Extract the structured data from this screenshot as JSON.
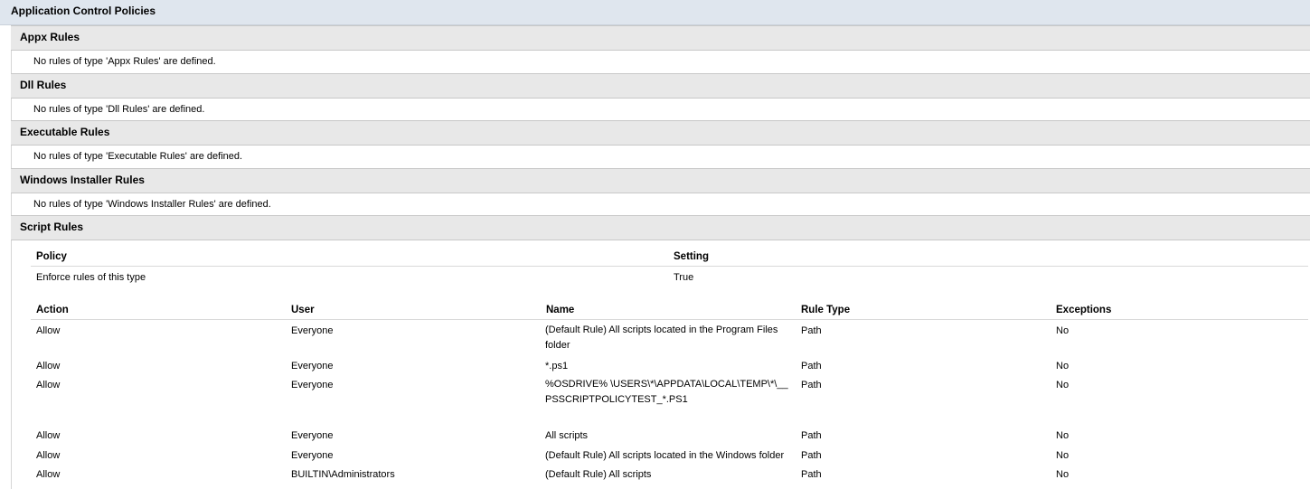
{
  "title": "Application Control Policies",
  "sections": [
    {
      "name": "Appx Rules",
      "message": "No rules of type 'Appx Rules' are defined."
    },
    {
      "name": "Dll Rules",
      "message": "No rules of type 'Dll Rules' are defined."
    },
    {
      "name": "Executable Rules",
      "message": "No rules of type 'Executable Rules' are defined."
    },
    {
      "name": "Windows Installer Rules",
      "message": "No rules of type 'Windows Installer Rules' are defined."
    }
  ],
  "script_rules": {
    "name": "Script Rules",
    "policy_headers": [
      "Policy",
      "Setting"
    ],
    "policy_row": [
      "Enforce rules of this type",
      "True"
    ],
    "rule_headers": [
      "Action",
      "User",
      "Name",
      "Rule Type",
      "Exceptions"
    ],
    "rules": [
      {
        "action": "Allow",
        "user": "Everyone",
        "name": "(Default Rule) All scripts located in the Program Files folder",
        "type": "Path",
        "exceptions": "No"
      },
      {
        "action": "Allow",
        "user": "Everyone",
        "name": "*.ps1",
        "type": "Path",
        "exceptions": "No"
      },
      {
        "action": "Allow",
        "user": "Everyone",
        "name": "%OSDRIVE% \\USERS\\*\\APPDATA\\LOCAL\\TEMP\\*\\__PSSCRIPTPOLICYTEST_*.PS1",
        "type": "Path",
        "exceptions": "No"
      },
      {
        "action": "Allow",
        "user": "Everyone",
        "name": "All scripts",
        "type": "Path",
        "exceptions": "No"
      },
      {
        "action": "Allow",
        "user": "Everyone",
        "name": "(Default Rule) All scripts located in the Windows folder",
        "type": "Path",
        "exceptions": "No"
      },
      {
        "action": "Allow",
        "user": "BUILTIN\\Administrators",
        "name": "(Default Rule) All scripts",
        "type": "Path",
        "exceptions": "No"
      }
    ]
  }
}
